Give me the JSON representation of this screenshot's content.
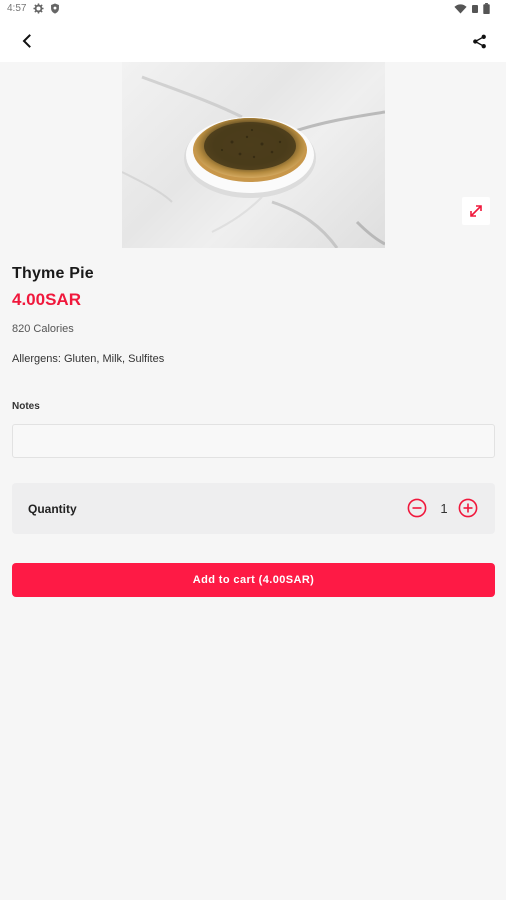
{
  "status_bar": {
    "time": "4:57",
    "left_icons": [
      "settings-icon",
      "shield-icon"
    ],
    "right_icons": [
      "wifi-icon",
      "battery-icon"
    ]
  },
  "app_bar": {
    "back_icon": "back-arrow-icon",
    "share_icon": "share-icon"
  },
  "product": {
    "image_alt": "Thyme pie on a white plate on marble",
    "name": "Thyme Pie",
    "price": "4.00SAR",
    "calories": "820 Calories",
    "allergens": "Allergens: Gluten, Milk, Sulfites",
    "expand_icon": "expand-icon"
  },
  "notes": {
    "label": "Notes",
    "value": "",
    "placeholder": ""
  },
  "quantity": {
    "label": "Quantity",
    "value": "1",
    "minus_icon": "minus-circle-icon",
    "plus_icon": "plus-circle-icon"
  },
  "cart": {
    "button_label": "Add to cart (4.00SAR)"
  },
  "colors": {
    "accent": "#fe1a45",
    "price": "#f0183c",
    "background": "#f6f6f6"
  }
}
